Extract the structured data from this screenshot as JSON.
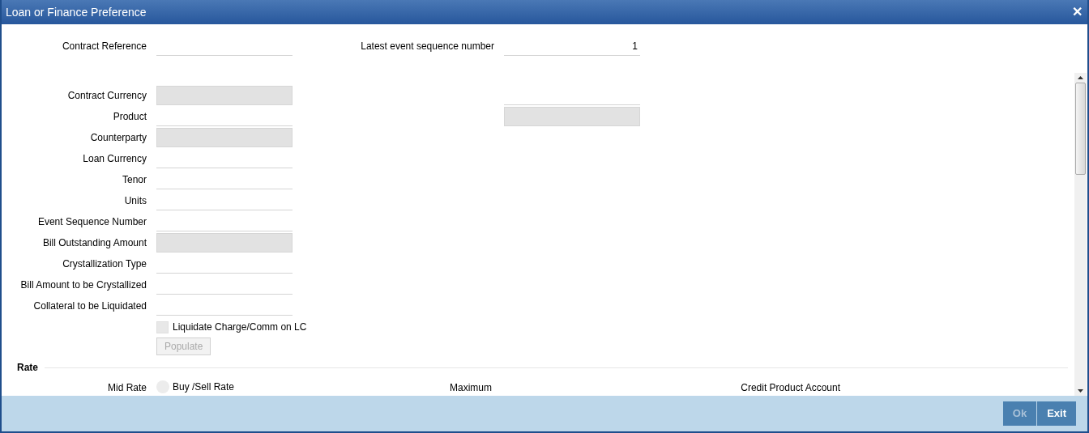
{
  "window": {
    "title": "Loan or Finance Preference",
    "close": "✕"
  },
  "header": {
    "fields": [
      {
        "label": "Contract Reference",
        "disabled": false
      },
      {
        "label": "Latest event sequence number",
        "value": "1",
        "disabled": false
      }
    ]
  },
  "left_fields": [
    {
      "label": "Contract Currency",
      "disabled": true
    },
    {
      "label": "Product",
      "disabled": false
    },
    {
      "label": "Counterparty",
      "disabled": true
    },
    {
      "label": "Loan Currency",
      "disabled": false
    },
    {
      "label": "Tenor",
      "disabled": false
    },
    {
      "label": "Units",
      "disabled": false
    },
    {
      "label": "Event Sequence Number",
      "disabled": false
    },
    {
      "label": "Bill Outstanding Amount",
      "disabled": true
    },
    {
      "label": "Crystallization Type",
      "disabled": false
    },
    {
      "label": "Bill Amount to be Crystallized",
      "disabled": false
    },
    {
      "label": "Collateral to be Liquidated",
      "disabled": false
    }
  ],
  "right_fields": [
    {
      "disabled": false
    },
    {
      "disabled": true
    }
  ],
  "checkbox": {
    "label": "Liquidate Charge/Comm on LC",
    "checked": false
  },
  "populate_button": {
    "label": "Populate",
    "disabled": true
  },
  "rate": {
    "heading": "Rate",
    "mid_rate_label": "Mid Rate",
    "radio": {
      "label": "Buy /Sell Rate",
      "selected": false
    },
    "maximum_label": "Maximum",
    "credit_product_account_label": "Credit Product Account"
  },
  "footer": {
    "buttons": [
      {
        "label": "Ok",
        "disabled": true
      },
      {
        "label": "Exit",
        "disabled": false
      }
    ]
  }
}
